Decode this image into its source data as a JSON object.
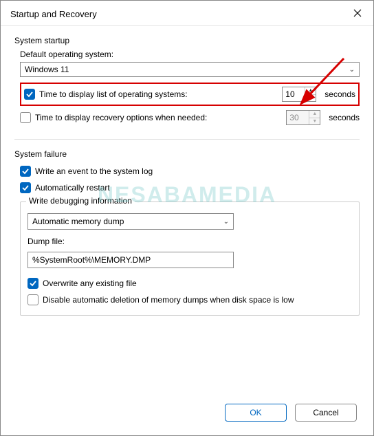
{
  "dialog": {
    "title": "Startup and Recovery"
  },
  "system_startup": {
    "section_label": "System startup",
    "default_os_label": "Default operating system:",
    "default_os_value": "Windows 11",
    "time_list_checked": true,
    "time_list_label": "Time to display list of operating systems:",
    "time_list_value": "10",
    "time_list_suffix": "seconds",
    "time_recovery_checked": false,
    "time_recovery_label": "Time to display recovery options when needed:",
    "time_recovery_value": "30",
    "time_recovery_suffix": "seconds"
  },
  "system_failure": {
    "section_label": "System failure",
    "write_event_checked": true,
    "write_event_label": "Write an event to the system log",
    "auto_restart_checked": true,
    "auto_restart_label": "Automatically restart",
    "debug_group_label": "Write debugging information",
    "debug_select_value": "Automatic memory dump",
    "dump_file_label": "Dump file:",
    "dump_file_value": "%SystemRoot%\\MEMORY.DMP",
    "overwrite_checked": true,
    "overwrite_label": "Overwrite any existing file",
    "disable_auto_delete_checked": false,
    "disable_auto_delete_label": "Disable automatic deletion of memory dumps when disk space is low"
  },
  "buttons": {
    "ok": "OK",
    "cancel": "Cancel"
  },
  "watermark": "NESABAMEDIA"
}
